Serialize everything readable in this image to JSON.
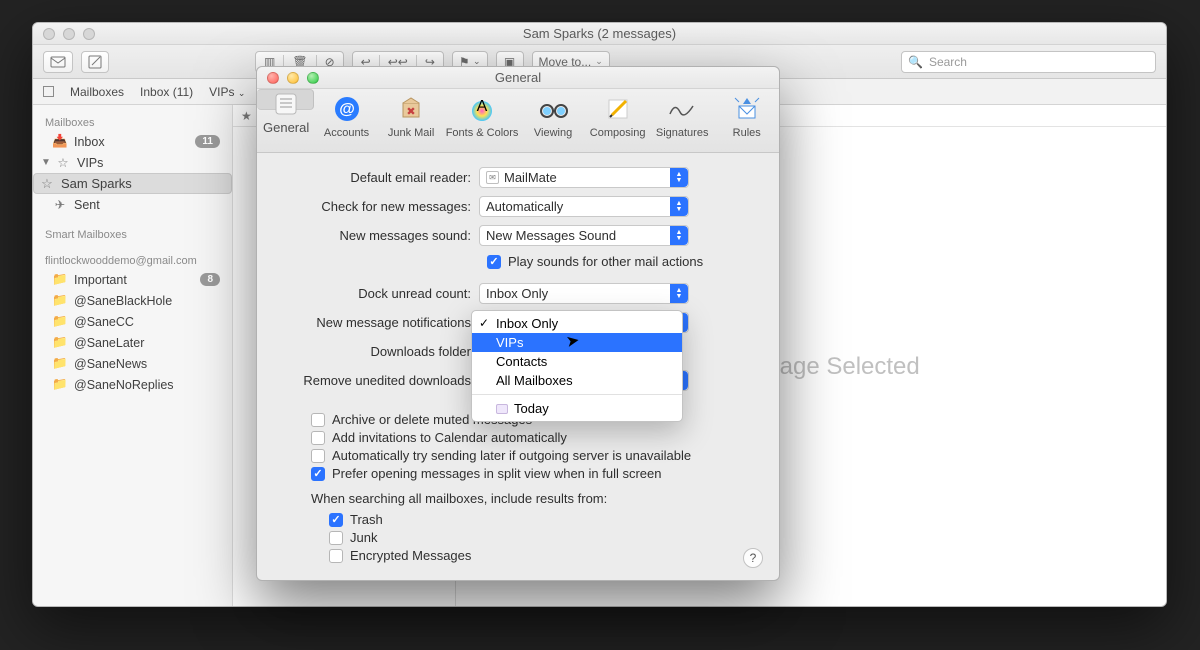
{
  "mail_window": {
    "title": "Sam Sparks (2 messages)",
    "moveto": "Move to...",
    "search_placeholder": "Search",
    "favbar": {
      "mailboxes": "Mailboxes",
      "inbox": "Inbox (11)",
      "vips": "VIPs"
    }
  },
  "sidebar": {
    "headers": {
      "mailboxes": "Mailboxes",
      "smart": "Smart Mailboxes"
    },
    "inbox": {
      "label": "Inbox",
      "badge": "11"
    },
    "vips": "VIPs",
    "sam": "Sam Sparks",
    "sent": "Sent",
    "account": "flintlockwooddemo@gmail.com",
    "folders": [
      {
        "label": "Important",
        "badge": "8"
      },
      {
        "label": "@SaneBlackHole"
      },
      {
        "label": "@SaneCC"
      },
      {
        "label": "@SaneLater"
      },
      {
        "label": "@SaneNews"
      },
      {
        "label": "@SaneNoReplies"
      }
    ]
  },
  "reader_empty": "o Message Selected",
  "prefs": {
    "title": "General",
    "tabs": [
      "General",
      "Accounts",
      "Junk Mail",
      "Fonts & Colors",
      "Viewing",
      "Composing",
      "Signatures",
      "Rules"
    ],
    "labels": {
      "default_reader": "Default email reader:",
      "check_new": "Check for new messages:",
      "sound": "New messages sound:",
      "play_sounds": "Play sounds for other mail actions",
      "dock": "Dock unread count:",
      "notifications": "New message notifications",
      "downloads": "Downloads folder",
      "remove_dl": "Remove unedited downloads",
      "archive": "Archive or delete muted messages",
      "addcal": "Add invitations to Calendar automatically",
      "retry": "Automatically try sending later if outgoing server is unavailable",
      "split": "Prefer opening messages in split view when in full screen",
      "search_header": "When searching all mailboxes, include results from:",
      "trash": "Trash",
      "junk": "Junk",
      "encrypted": "Encrypted Messages"
    },
    "values": {
      "default_reader": "MailMate",
      "check_new": "Automatically",
      "sound": "New Messages Sound",
      "dock": "Inbox Only"
    },
    "checked": {
      "play_sounds": true,
      "archive": false,
      "addcal": false,
      "retry": false,
      "split": true,
      "trash": true,
      "junk": false,
      "encrypted": false
    }
  },
  "dropdown": {
    "items": [
      "Inbox Only",
      "VIPs",
      "Contacts",
      "All Mailboxes"
    ],
    "checked_index": 0,
    "highlight_index": 1,
    "extra": "Today"
  }
}
